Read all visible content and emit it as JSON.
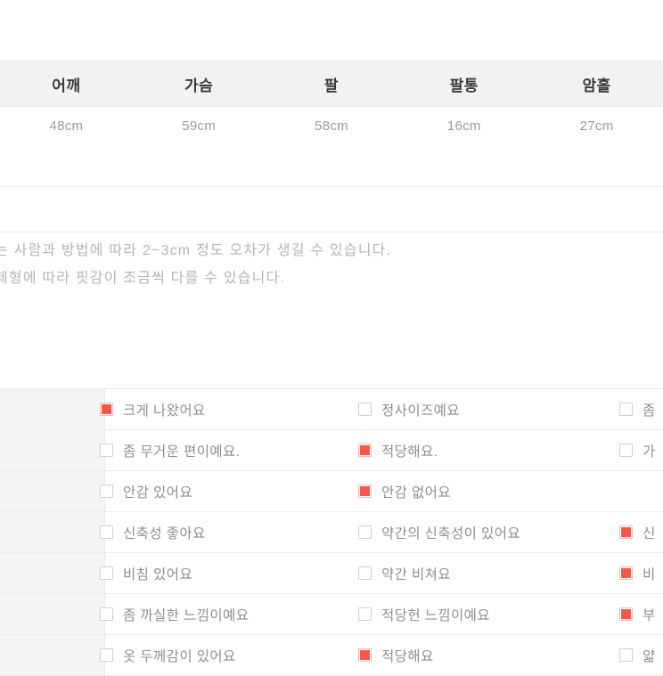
{
  "size_table": {
    "headers": [
      "어깨",
      "가슴",
      "팔",
      "팔통",
      "암홀"
    ],
    "values": [
      "48cm",
      "59cm",
      "58cm",
      "16cm",
      "27cm"
    ]
  },
  "notes": {
    "lines": [
      "는 사람과 방법에 따라 2~3cm 정도 오차가 생길 수 있습니다.",
      "체형에 따라 핏감이 조금씩 다를 수 있습니다."
    ]
  },
  "review": {
    "rows": [
      {
        "label": "",
        "options": [
          {
            "text": "크게 나왔어요",
            "checked": true
          },
          {
            "text": "정사이즈예요",
            "checked": false
          },
          {
            "text": "좀",
            "checked": false
          }
        ]
      },
      {
        "label": "",
        "options": [
          {
            "text": "좀 무거운 편이예요.",
            "checked": false
          },
          {
            "text": "적당해요.",
            "checked": true
          },
          {
            "text": "가",
            "checked": false
          }
        ]
      },
      {
        "label": "",
        "options": [
          {
            "text": "안감 있어요",
            "checked": false
          },
          {
            "text": "안감 없어요",
            "checked": true
          }
        ]
      },
      {
        "label": "",
        "options": [
          {
            "text": "신축성 좋아요",
            "checked": false
          },
          {
            "text": "약간의 신축성이 있어요",
            "checked": false
          },
          {
            "text": "신",
            "checked": true
          }
        ]
      },
      {
        "label": "",
        "options": [
          {
            "text": "비침 있어요",
            "checked": false
          },
          {
            "text": "약간 비쳐요",
            "checked": false
          },
          {
            "text": "비",
            "checked": true
          }
        ]
      },
      {
        "label": "",
        "options": [
          {
            "text": "좀 까실한 느낌이예요",
            "checked": false
          },
          {
            "text": "적당헌 느낌이예요",
            "checked": false
          },
          {
            "text": "부",
            "checked": true
          }
        ]
      },
      {
        "label": "",
        "options": [
          {
            "text": "옷 두께감이 있어요",
            "checked": false
          },
          {
            "text": "적당해요",
            "checked": true
          },
          {
            "text": "얇",
            "checked": false
          }
        ]
      }
    ]
  },
  "colors": {
    "checked_fill": "#f8564a",
    "checked_border": "#f8b9b3",
    "unchecked_border": "#cfcfcf",
    "header_bg": "#f2f2f2",
    "label_bg": "#f4f4f4",
    "text_muted": "#8e8e8e"
  }
}
